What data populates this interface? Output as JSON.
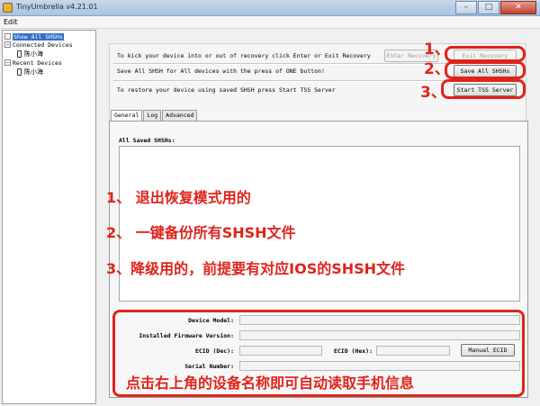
{
  "window": {
    "title": "TinyUmbrella v4.21.01",
    "menu": "Edit",
    "buttons": [
      "–",
      "□",
      "✕"
    ]
  },
  "tree": {
    "items": [
      {
        "label": "Show All SHSHs",
        "expander": "",
        "selected": true,
        "kind": "root"
      },
      {
        "label": "Connected Devices",
        "expander": "−",
        "kind": "group"
      },
      {
        "label": "陈小海",
        "kind": "device"
      },
      {
        "label": "Recent Devices",
        "expander": "−",
        "kind": "group"
      },
      {
        "label": "陈小海",
        "kind": "device"
      }
    ]
  },
  "actions": {
    "recovery_text": "To kick your device into or out of recovery click Enter or Exit Recovery",
    "save_text": "Save All SHSH for All devices with the press of ONE button!",
    "restore_text": "To restore your device using saved SHSH press Start TSS Server",
    "enter_recovery": "Enter Recovery",
    "exit_recovery": "Exit Recovery",
    "save_all": "Save All SHSHs",
    "start_tss": "Start TSS Server"
  },
  "tabs": [
    {
      "label": "General",
      "active": true
    },
    {
      "label": "Log",
      "active": false
    },
    {
      "label": "Advanced",
      "active": false
    }
  ],
  "panel": {
    "heading": "All Saved SHSHs:",
    "device_model": "Device Model:",
    "firmware": "Installed Firmware Version:",
    "ecid_dec": "ECID (Dec):",
    "ecid_hex": "ECID (Hex):",
    "manual_ecid": "Manual ECID",
    "serial": "Serial Number:"
  },
  "annotations": {
    "n1": "1、",
    "n2": "2、",
    "n3": "3、",
    "line1": "1、 退出恢复模式用的",
    "line2": "2、 一键备份所有SHSH文件",
    "line3": "3、降级用的，前提要有对应IOS的SHSH文件",
    "bottom": "点击右上角的设备名称即可自动读取手机信息",
    "color": "#e0231c"
  }
}
